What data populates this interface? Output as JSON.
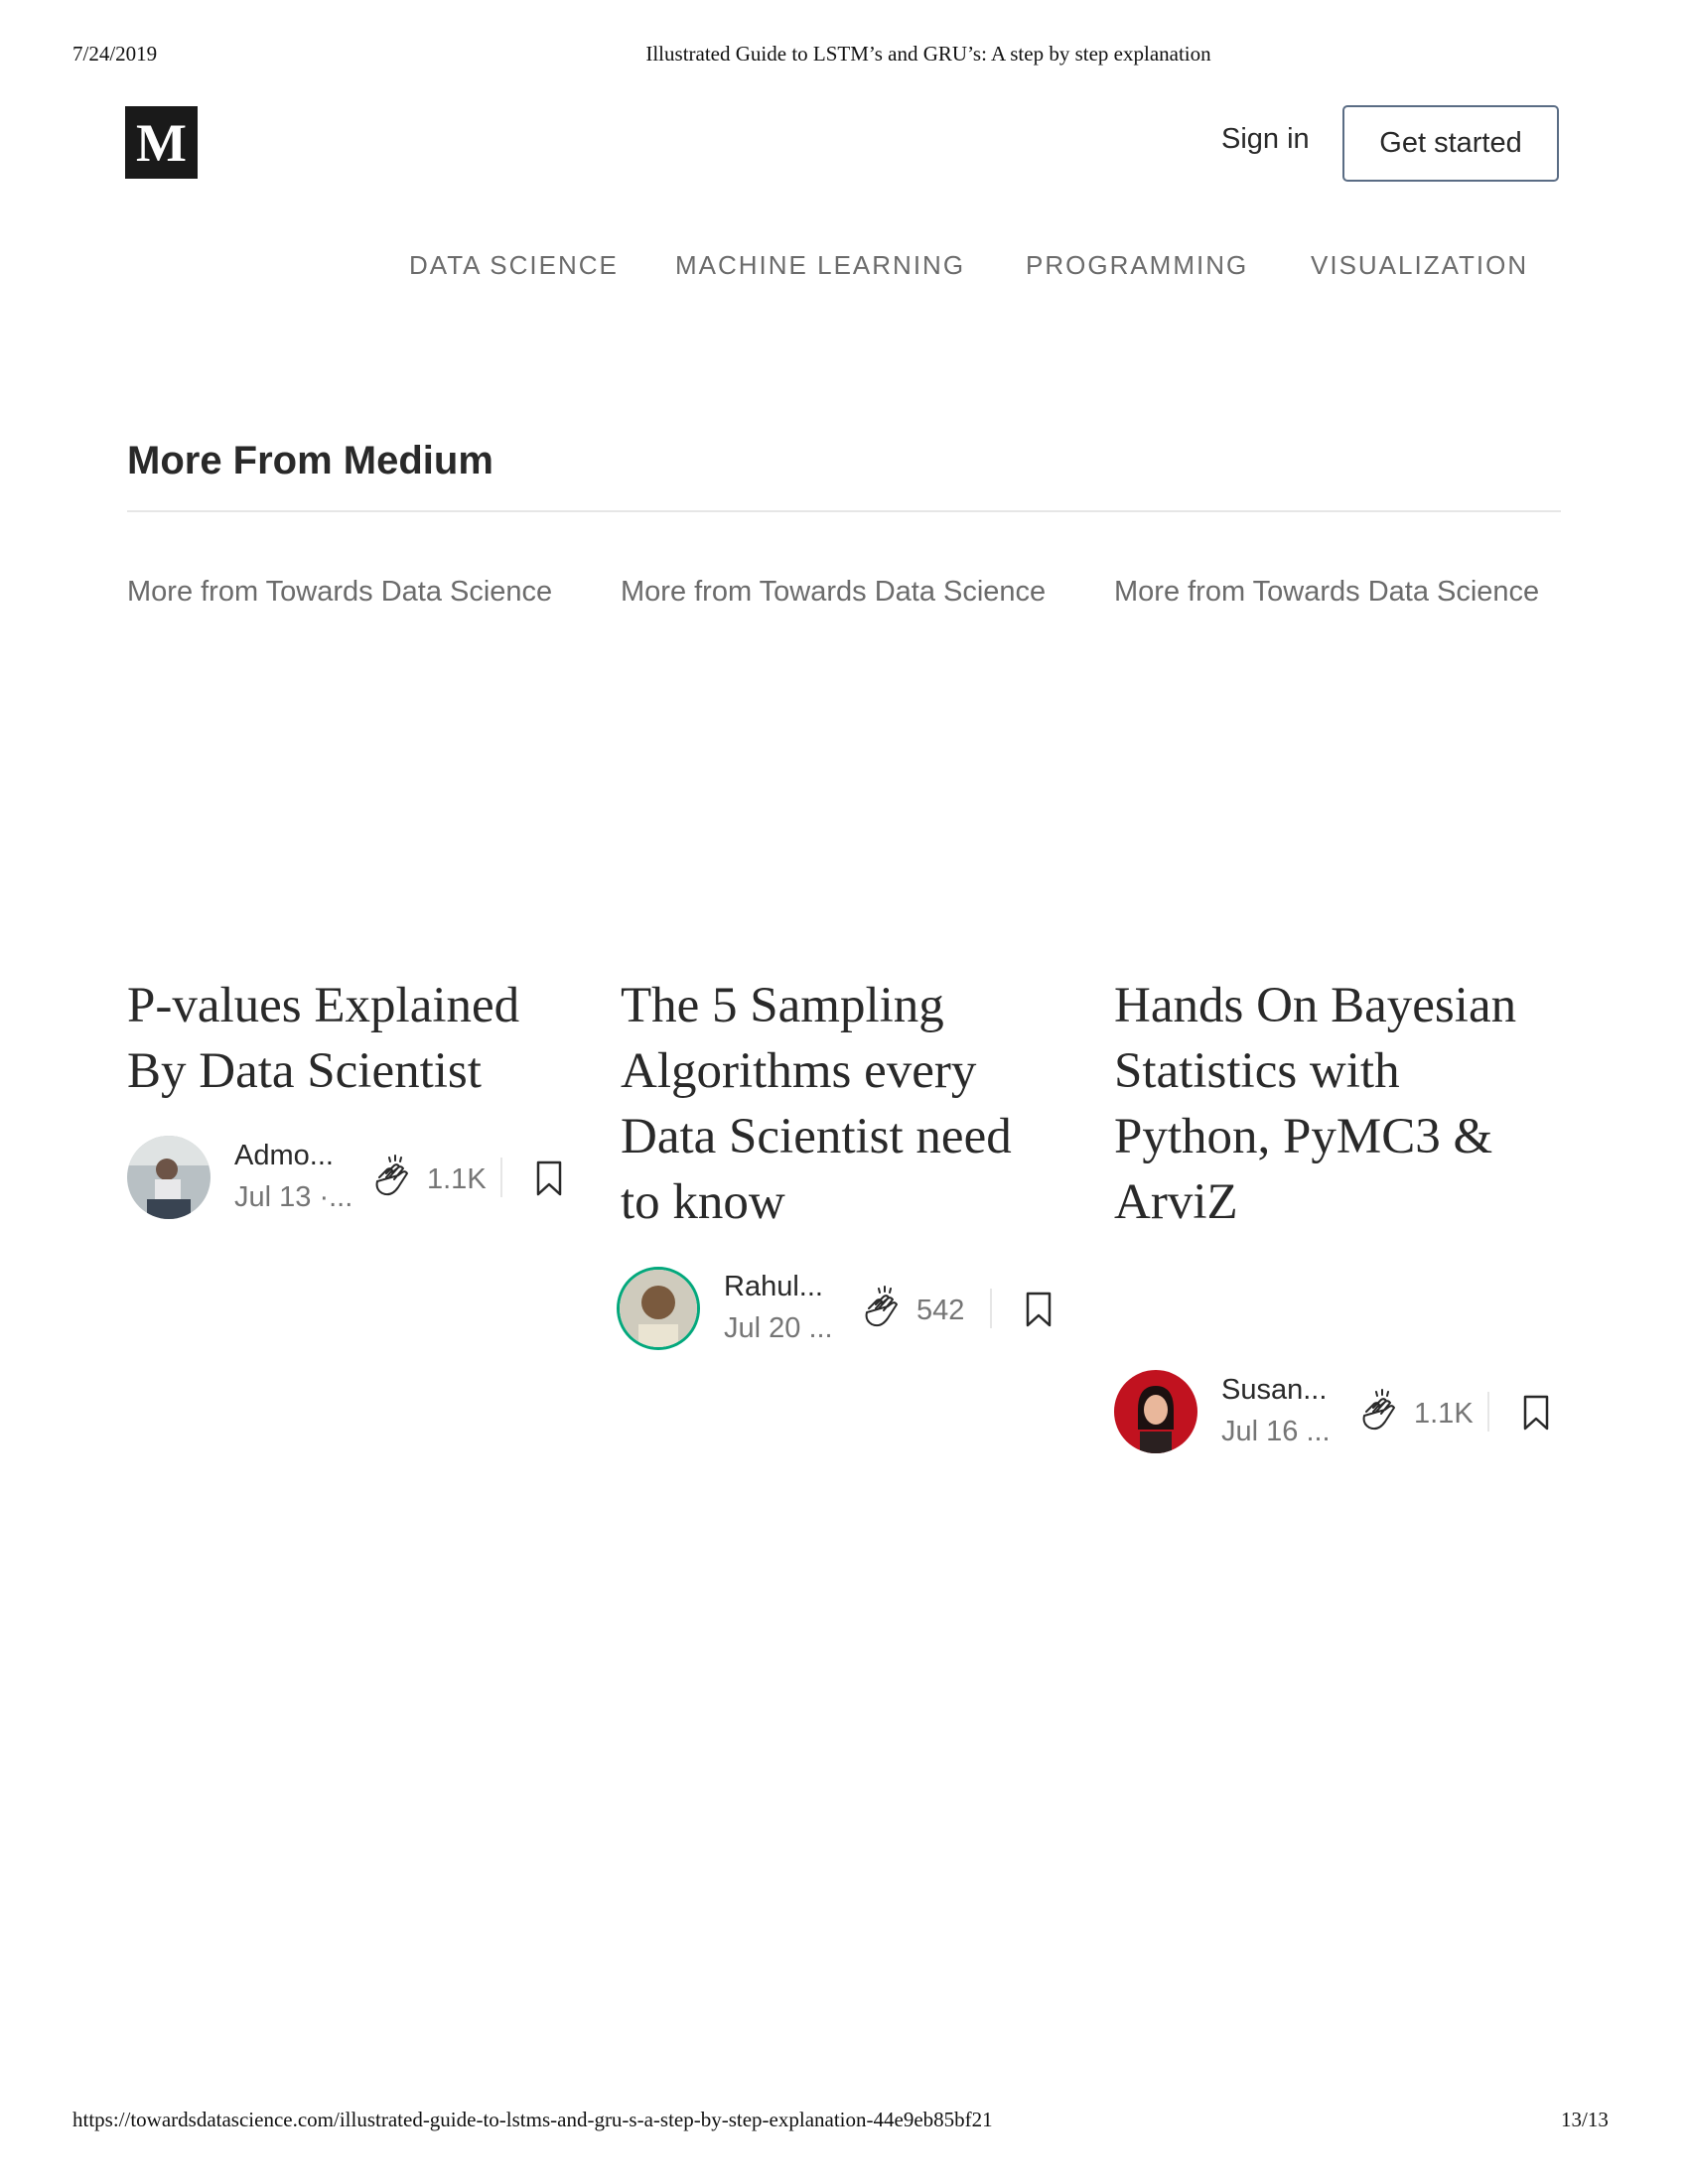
{
  "print": {
    "date": "7/24/2019",
    "title": "Illustrated Guide to LSTM’s and GRU’s: A step by step explanation",
    "url": "https://towardsdatascience.com/illustrated-guide-to-lstms-and-gru-s-a-step-by-step-explanation-44e9eb85bf21",
    "page": "13/13"
  },
  "header": {
    "logo_letter": "M",
    "sign_in": "Sign in",
    "get_started": "Get started"
  },
  "nav": [
    "DATA SCIENCE",
    "MACHINE LEARNING",
    "PROGRAMMING",
    "VISUALIZATION"
  ],
  "section": {
    "title": "More From Medium"
  },
  "cards": [
    {
      "pub": "More from Towards Data Science",
      "title": "P-values Explained By Data Scientist",
      "author": "Admo...",
      "date": "Jul 13 ·...",
      "claps": "1.1K",
      "avatar_icon": "author-photo"
    },
    {
      "pub": "More from Towards Data Science",
      "title": "The 5 Sampling Algorithms every Data Scientist need to know",
      "author": "Rahul...",
      "date": "Jul 20 ...",
      "claps": "542",
      "avatar_icon": "author-photo"
    },
    {
      "pub": "More from Towards Data Science",
      "title": "Hands On Bayesian Statistics with Python, PyMC3 & ArviZ",
      "author": "Susan...",
      "date": "Jul 16 ...",
      "claps": "1.1K",
      "avatar_icon": "author-photo"
    }
  ],
  "colors": {
    "accent": "#5a6c84",
    "text": "#292929",
    "muted": "#757575"
  }
}
